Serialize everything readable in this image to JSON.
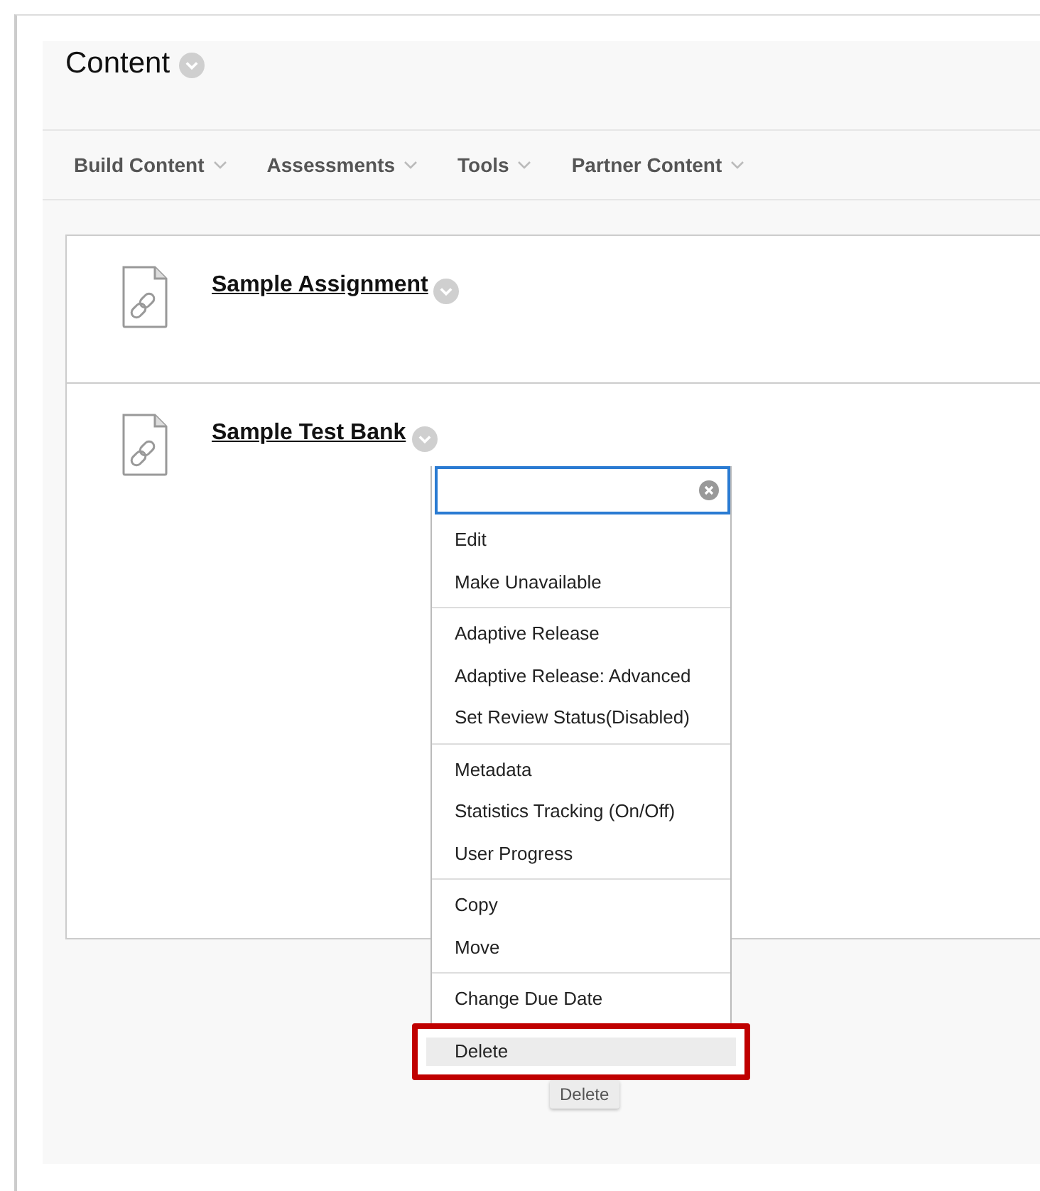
{
  "page": {
    "title": "Content"
  },
  "nav": [
    {
      "label": "Build Content"
    },
    {
      "label": "Assessments"
    },
    {
      "label": "Tools"
    },
    {
      "label": "Partner Content"
    }
  ],
  "items": [
    {
      "title": "Sample Assignment"
    },
    {
      "title": "Sample Test Bank"
    }
  ],
  "menu": {
    "groups": [
      {
        "items": [
          {
            "label": "Edit",
            "highlighted": false,
            "callout": false
          },
          {
            "label": "Make Unavailable",
            "highlighted": false,
            "callout": false
          }
        ]
      },
      {
        "items": [
          {
            "label": "Adaptive Release",
            "highlighted": false,
            "callout": false
          },
          {
            "label": "Adaptive Release: Advanced",
            "highlighted": false,
            "callout": false
          },
          {
            "label": "Set Review Status(Disabled)",
            "highlighted": false,
            "callout": false
          }
        ]
      },
      {
        "items": [
          {
            "label": "Metadata",
            "highlighted": false,
            "callout": false
          },
          {
            "label": "Statistics Tracking (On/Off)",
            "highlighted": false,
            "callout": false
          },
          {
            "label": "User Progress",
            "highlighted": false,
            "callout": false
          }
        ]
      },
      {
        "items": [
          {
            "label": "Copy",
            "highlighted": false,
            "callout": false
          },
          {
            "label": "Move",
            "highlighted": false,
            "callout": false
          }
        ]
      },
      {
        "items": [
          {
            "label": "Change Due Date",
            "highlighted": false,
            "callout": false
          },
          {
            "label": "Delete",
            "highlighted": true,
            "callout": true
          }
        ]
      }
    ]
  },
  "tooltip": "Delete"
}
